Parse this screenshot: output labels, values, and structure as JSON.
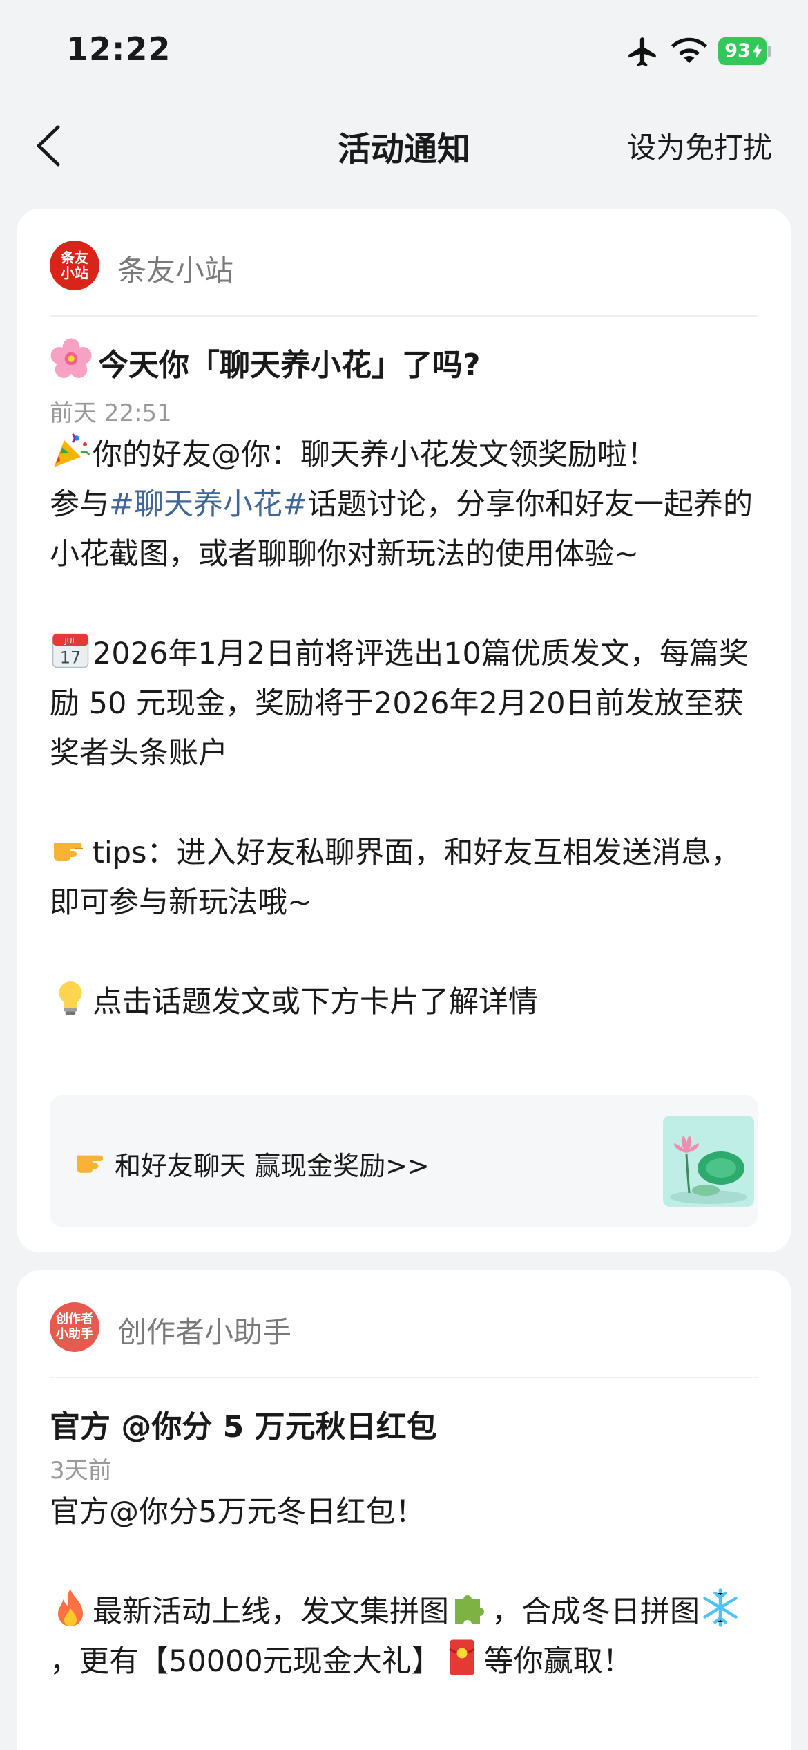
{
  "status_bar": {
    "time": "12:22",
    "battery": "93"
  },
  "nav": {
    "title": "活动通知",
    "action": "设为免打扰"
  },
  "notifications": [
    {
      "sender": "条友小站",
      "avatar_text": "条友小站",
      "title": "今天你「聊天养小花」了吗?",
      "time": "前天 22:51",
      "line1": "你的好友@你：聊天养小花发文领奖励啦！",
      "line2_pre": "参与",
      "line2_tag": "#聊天养小花#",
      "line2_post": "话题讨论，分享你和好友一起养的小花截图，或者聊聊你对新玩法的使用体验~",
      "para2": "2026年1月2日前将评选出10篇优质发文，每篇奖励 50 元现金，奖励将于2026年2月20日前发放至获奖者头条账户",
      "para3": "tips：进入好友私聊界面，和好友互相发送消息，即可参与新玩法哦~",
      "para4": "点击话题发文或下方卡片了解详情",
      "link_text": "和好友聊天 赢现金奖励>>",
      "icons": [
        "cherry-blossom-icon",
        "party-popper-icon",
        "calendar-icon",
        "pointing-hand-icon",
        "light-bulb-icon",
        "lotus-thumbnail"
      ]
    },
    {
      "sender": "创作者小助手",
      "avatar_text": "创作者小助手",
      "title": "官方 @你分 5 万元秋日红包",
      "time": "3天前",
      "line1": "官方@你分5万元冬日红包！",
      "para2_a": "最新活动上线，发文集拼图",
      "para2_b": "，合成冬日拼图",
      "para2_c": "，更有【50000元现金大礼】",
      "para2_d": "等你赢取！",
      "icons": [
        "fire-icon",
        "puzzle-icon",
        "snowflake-icon",
        "red-envelope-icon"
      ]
    }
  ],
  "colors": {
    "background": "#f2f3f5",
    "hashtag": "#406599",
    "battery": "#34c759",
    "avatar_red": "#d9241a"
  }
}
